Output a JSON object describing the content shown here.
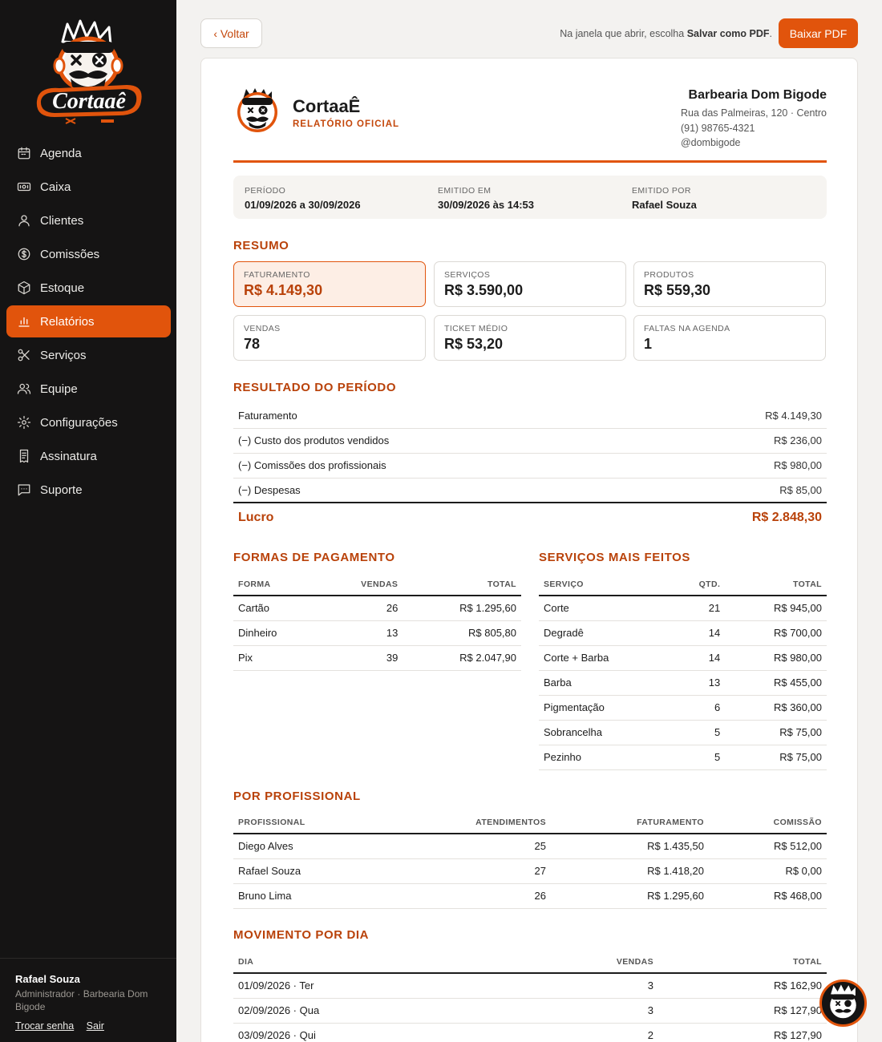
{
  "brand": {
    "logo_text": "Cortaaê",
    "colors": {
      "accent": "#e1540c",
      "dark": "#151414",
      "title": "#b9420a"
    }
  },
  "sidebar": {
    "items": [
      {
        "label": "Agenda",
        "icon": "calendar-icon"
      },
      {
        "label": "Caixa",
        "icon": "cash-icon"
      },
      {
        "label": "Clientes",
        "icon": "user-icon"
      },
      {
        "label": "Comissões",
        "icon": "dollar-circle-icon"
      },
      {
        "label": "Estoque",
        "icon": "box-icon"
      },
      {
        "label": "Relatórios",
        "icon": "bar-chart-icon",
        "active": true
      },
      {
        "label": "Serviços",
        "icon": "scissors-icon"
      },
      {
        "label": "Equipe",
        "icon": "users-icon"
      },
      {
        "label": "Configurações",
        "icon": "gear-icon"
      },
      {
        "label": "Assinatura",
        "icon": "receipt-icon"
      },
      {
        "label": "Suporte",
        "icon": "chat-icon"
      }
    ],
    "user": {
      "name": "Rafael Souza",
      "role": "Administrador · Barbearia Dom Bigode",
      "change_password": "Trocar senha",
      "logout": "Sair"
    }
  },
  "topbar": {
    "back_label": "‹ Voltar",
    "hint_prefix": "Na janela que abrir, escolha ",
    "hint_bold": "Salvar como PDF",
    "hint_suffix": ".",
    "download_label": "Baixar PDF"
  },
  "report": {
    "brand_name": "CortaaÊ",
    "brand_subtitle": "RELATÓRIO OFICIAL",
    "shop": {
      "name": "Barbearia Dom Bigode",
      "address": "Rua das Palmeiras, 120 · Centro",
      "phone": "(91) 98765-4321",
      "instagram": "@dombigode"
    },
    "meta": [
      {
        "label": "PERÍODO",
        "value": "01/09/2026 a 30/09/2026"
      },
      {
        "label": "EMITIDO EM",
        "value": "30/09/2026 às 14:53"
      },
      {
        "label": "EMITIDO POR",
        "value": "Rafael Souza"
      }
    ],
    "summary_title": "RESUMO",
    "kpis": [
      {
        "label": "FATURAMENTO",
        "value": "R$ 4.149,30"
      },
      {
        "label": "SERVIÇOS",
        "value": "R$ 3.590,00"
      },
      {
        "label": "PRODUTOS",
        "value": "R$ 559,30"
      },
      {
        "label": "VENDAS",
        "value": "78"
      },
      {
        "label": "TICKET MÉDIO",
        "value": "R$ 53,20"
      },
      {
        "label": "FALTAS NA AGENDA",
        "value": "1"
      }
    ],
    "result_title": "RESULTADO DO PERÍODO",
    "result_rows": [
      {
        "label": "Faturamento",
        "value": "R$ 4.149,30"
      },
      {
        "label": "(−) Custo dos produtos vendidos",
        "value": "R$ 236,00"
      },
      {
        "label": "(−) Comissões dos profissionais",
        "value": "R$ 980,00"
      },
      {
        "label": "(−) Despesas",
        "value": "R$ 85,00"
      }
    ],
    "profit": {
      "label": "Lucro",
      "value": "R$ 2.848,30"
    },
    "payments_title": "FORMAS DE PAGAMENTO",
    "payments_headers": [
      "FORMA",
      "VENDAS",
      "TOTAL"
    ],
    "payments": [
      {
        "forma": "Cartão",
        "vendas": "26",
        "total": "R$ 1.295,60"
      },
      {
        "forma": "Dinheiro",
        "vendas": "13",
        "total": "R$ 805,80"
      },
      {
        "forma": "Pix",
        "vendas": "39",
        "total": "R$ 2.047,90"
      }
    ],
    "services_title": "SERVIÇOS MAIS FEITOS",
    "services_headers": [
      "SERVIÇO",
      "QTD.",
      "TOTAL"
    ],
    "services": [
      {
        "servico": "Corte",
        "qtd": "21",
        "total": "R$ 945,00"
      },
      {
        "servico": "Degradê",
        "qtd": "14",
        "total": "R$ 700,00"
      },
      {
        "servico": "Corte + Barba",
        "qtd": "14",
        "total": "R$ 980,00"
      },
      {
        "servico": "Barba",
        "qtd": "13",
        "total": "R$ 455,00"
      },
      {
        "servico": "Pigmentação",
        "qtd": "6",
        "total": "R$ 360,00"
      },
      {
        "servico": "Sobrancelha",
        "qtd": "5",
        "total": "R$ 75,00"
      },
      {
        "servico": "Pezinho",
        "qtd": "5",
        "total": "R$ 75,00"
      }
    ],
    "pros_title": "POR PROFISSIONAL",
    "pros_headers": [
      "PROFISSIONAL",
      "ATENDIMENTOS",
      "FATURAMENTO",
      "COMISSÃO"
    ],
    "pros": [
      {
        "nome": "Diego Alves",
        "atend": "25",
        "fat": "R$ 1.435,50",
        "com": "R$ 512,00"
      },
      {
        "nome": "Rafael Souza",
        "atend": "27",
        "fat": "R$ 1.418,20",
        "com": "R$ 0,00"
      },
      {
        "nome": "Bruno Lima",
        "atend": "26",
        "fat": "R$ 1.295,60",
        "com": "R$ 468,00"
      }
    ],
    "daily_title": "MOVIMENTO POR DIA",
    "daily_headers": [
      "DIA",
      "VENDAS",
      "TOTAL"
    ],
    "daily": [
      {
        "dia": "01/09/2026 · Ter",
        "vendas": "3",
        "total": "R$ 162,90"
      },
      {
        "dia": "02/09/2026 · Qua",
        "vendas": "3",
        "total": "R$ 127,90"
      },
      {
        "dia": "03/09/2026 · Qui",
        "vendas": "2",
        "total": "R$ 127,90"
      }
    ]
  }
}
